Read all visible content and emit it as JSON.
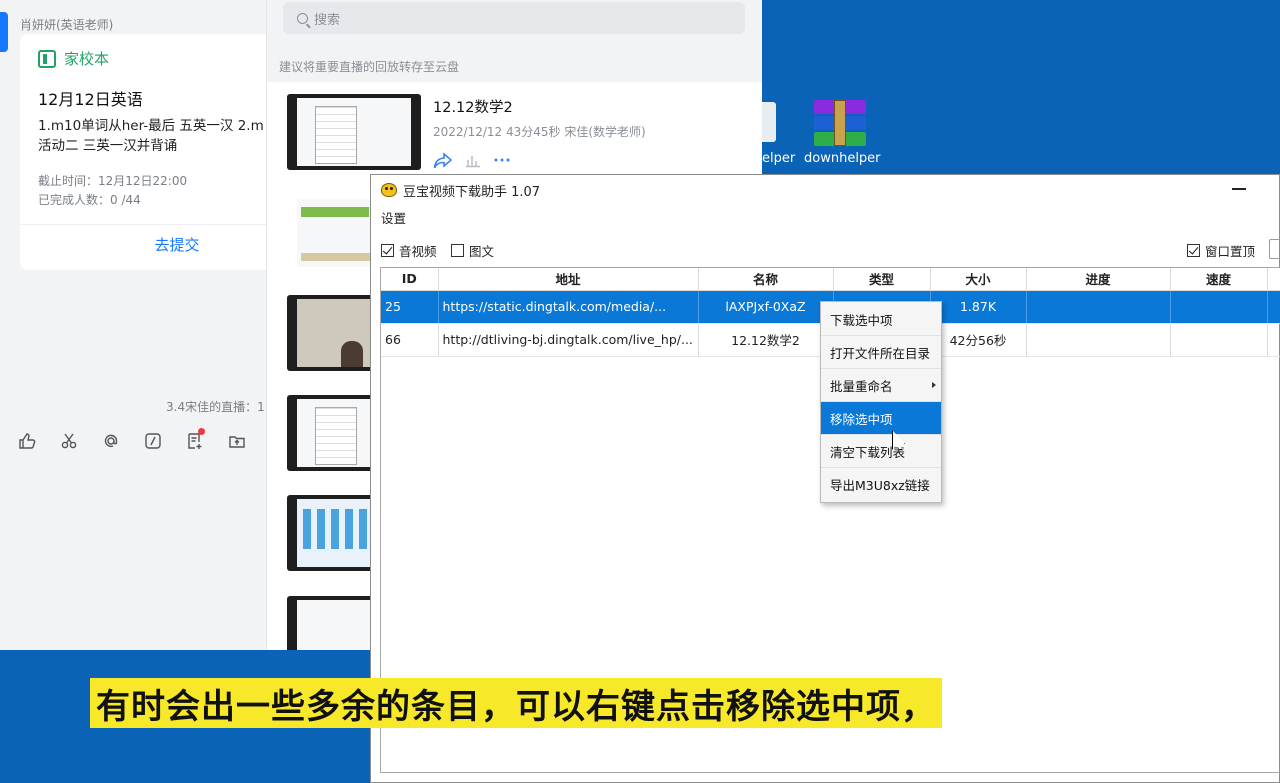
{
  "chat": {
    "sender": "肖妍妍(英语老师)",
    "card": {
      "app_name": "家校本",
      "title": "12月12日英语",
      "body_line1": "1.m10单词从her-最后 五英一汉 2.m",
      "body_line2": "活动二 三英一汉并背诵",
      "deadline": "截止时间：12月12日22:00",
      "completed": "已完成人数：0 /44",
      "submit": "去提交"
    },
    "note": "3.4宋佳的直播：1",
    "toolbar_icons": [
      "thumbs-up-icon",
      "scissors-icon",
      "at-icon",
      "slash-icon",
      "task-icon",
      "upload-icon"
    ]
  },
  "playback": {
    "search_placeholder": "搜索",
    "cloud_tip": "建议将重要直播的回放转存至云盘",
    "first": {
      "title": "12.12数学2",
      "meta": "2022/12/12 43分45秒 宋佳(数学老师)"
    }
  },
  "desktop": {
    "icon_left_label": "elper",
    "icon_right_label": "downhelper"
  },
  "downloader": {
    "title": "豆宝视频下载助手 1.07",
    "menu_settings": "设置",
    "opt_audio_video": "音视频",
    "opt_image_text": "图文",
    "opt_pin_window": "窗口置顶",
    "opt_audio_video_checked": true,
    "opt_image_text_checked": false,
    "opt_pin_window_checked": true,
    "columns": [
      "ID",
      "地址",
      "名称",
      "类型",
      "大小",
      "进度",
      "速度"
    ],
    "rows": [
      {
        "id": "25",
        "url": "https://static.dingtalk.com/media/...",
        "name": "lAXPJxf-0XaZ",
        "type": "",
        "size": "1.87K",
        "progress": "",
        "speed": "",
        "selected": true
      },
      {
        "id": "66",
        "url": "http://dtliving-bj.dingtalk.com/live_hp/...",
        "name": "12.12数学2",
        "type": "",
        "size": "42分56秒",
        "progress": "",
        "speed": "",
        "selected": false
      }
    ]
  },
  "context_menu": {
    "items": [
      "下载选中项",
      "打开文件所在目录",
      "批量重命名",
      "移除选中项",
      "清空下载列表",
      "导出M3U8xz链接"
    ],
    "active_index": 3
  },
  "caption": "有时会出一些多余的条目，可以右键点击移除选中项，",
  "colors": {
    "desktop_blue": "#0b63b8",
    "selection_blue": "#0a78d7",
    "caption_yellow": "#f7e92a",
    "app_green": "#21a366"
  }
}
